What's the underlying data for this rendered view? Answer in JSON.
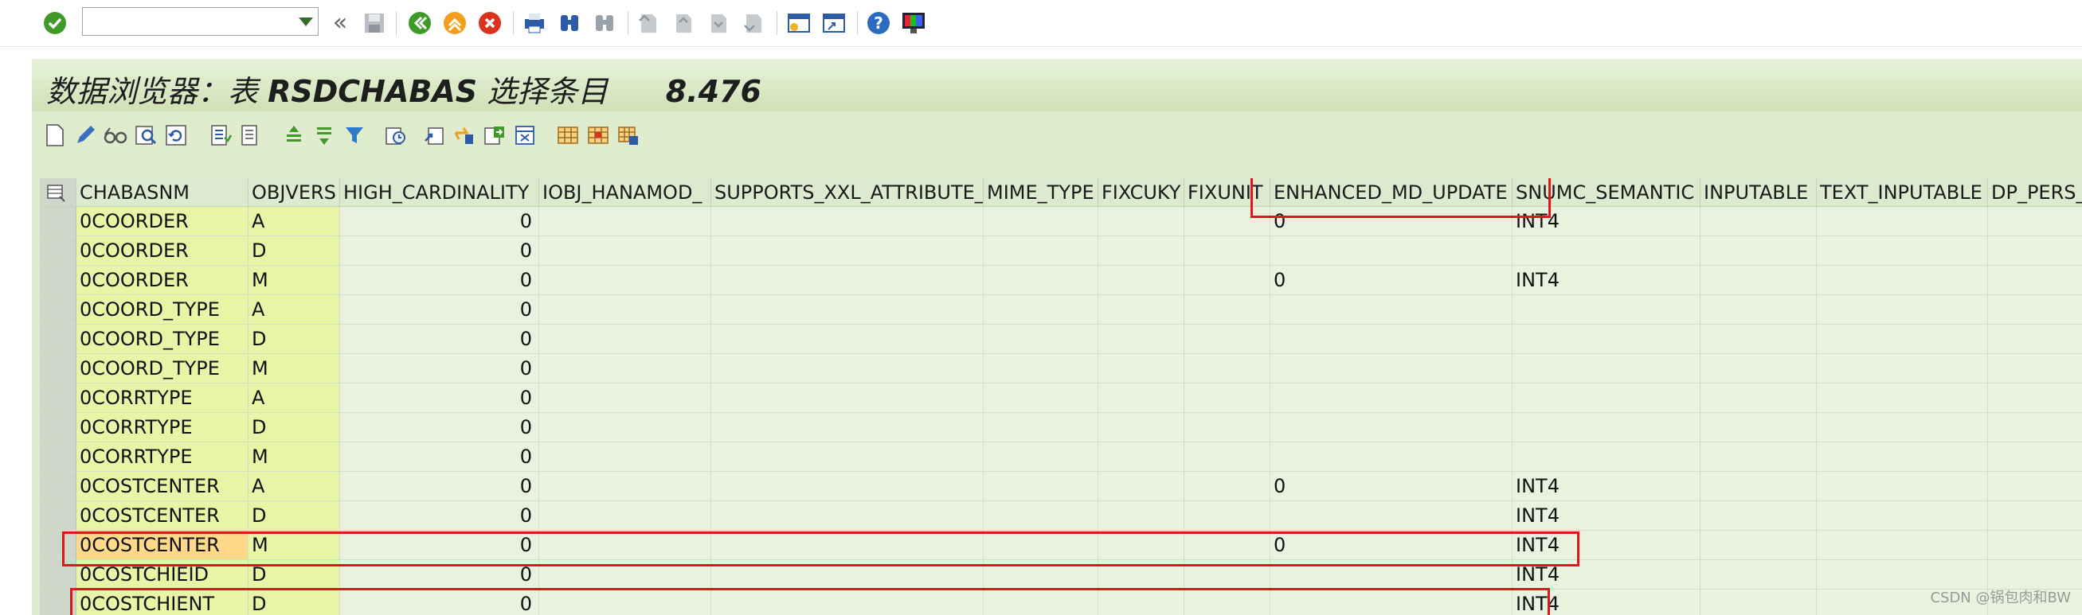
{
  "command_field": {
    "value": "",
    "placeholder": ""
  },
  "system_toolbar": {
    "icons": [
      "enter-icon",
      "back-double-icon",
      "save-icon",
      "back-icon",
      "exit-icon",
      "cancel-icon",
      "print-icon",
      "find-icon",
      "find-next-icon",
      "first-page-icon",
      "previous-page-icon",
      "next-page-icon",
      "last-page-icon",
      "create-session-icon",
      "shortcut-icon",
      "help-icon",
      "customize-layout-icon"
    ]
  },
  "title": {
    "prefix": "数据浏览器：表 ",
    "table": "RSDCHABAS",
    "suffix": " 选择条目",
    "count": "8.476"
  },
  "app_toolbar": {
    "icons": [
      "display-icon",
      "change-icon",
      "glasses-icon",
      "detail-icon",
      "refresh-icon",
      "check-table-icon",
      "check-table-2-icon",
      "sort-asc-icon",
      "sort-desc-icon",
      "filter-icon",
      "sum-icon",
      "export-icon",
      "find-icon",
      "print-icon",
      "excel-icon",
      "layout-icon",
      "select-layout-icon",
      "save-layout-icon"
    ]
  },
  "columns": [
    "CHABASNM",
    "OBJVERS",
    "HIGH_CARDINALITY",
    "IOBJ_HANAMOD_",
    "SUPPORTS_XXL_ATTRIBUTE_",
    "MIME_TYPE",
    "FIXCUKY",
    "FIXUNIT",
    "ENHANCED_MD_UPDATE",
    "SNUMC_SEMANTIC",
    "INPUTABLE",
    "TEXT_INPUTABLE",
    "DP_PERS_I"
  ],
  "rows": [
    {
      "CHABASNM": "0COORDER",
      "OBJVERS": "A",
      "HIGH_CARDINALITY": "0",
      "ENHANCED_MD_UPDATE": "0",
      "SNUMC_SEMANTIC": "INT4"
    },
    {
      "CHABASNM": "0COORDER",
      "OBJVERS": "D",
      "HIGH_CARDINALITY": "0",
      "ENHANCED_MD_UPDATE": "",
      "SNUMC_SEMANTIC": ""
    },
    {
      "CHABASNM": "0COORDER",
      "OBJVERS": "M",
      "HIGH_CARDINALITY": "0",
      "ENHANCED_MD_UPDATE": "0",
      "SNUMC_SEMANTIC": "INT4"
    },
    {
      "CHABASNM": "0COORD_TYPE",
      "OBJVERS": "A",
      "HIGH_CARDINALITY": "0",
      "ENHANCED_MD_UPDATE": "",
      "SNUMC_SEMANTIC": ""
    },
    {
      "CHABASNM": "0COORD_TYPE",
      "OBJVERS": "D",
      "HIGH_CARDINALITY": "0",
      "ENHANCED_MD_UPDATE": "",
      "SNUMC_SEMANTIC": ""
    },
    {
      "CHABASNM": "0COORD_TYPE",
      "OBJVERS": "M",
      "HIGH_CARDINALITY": "0",
      "ENHANCED_MD_UPDATE": "",
      "SNUMC_SEMANTIC": ""
    },
    {
      "CHABASNM": "0CORRTYPE",
      "OBJVERS": "A",
      "HIGH_CARDINALITY": "0",
      "ENHANCED_MD_UPDATE": "",
      "SNUMC_SEMANTIC": ""
    },
    {
      "CHABASNM": "0CORRTYPE",
      "OBJVERS": "D",
      "HIGH_CARDINALITY": "0",
      "ENHANCED_MD_UPDATE": "",
      "SNUMC_SEMANTIC": ""
    },
    {
      "CHABASNM": "0CORRTYPE",
      "OBJVERS": "M",
      "HIGH_CARDINALITY": "0",
      "ENHANCED_MD_UPDATE": "",
      "SNUMC_SEMANTIC": ""
    },
    {
      "CHABASNM": "0COSTCENTER",
      "OBJVERS": "A",
      "HIGH_CARDINALITY": "0",
      "ENHANCED_MD_UPDATE": "0",
      "SNUMC_SEMANTIC": "INT4"
    },
    {
      "CHABASNM": "0COSTCENTER",
      "OBJVERS": "D",
      "HIGH_CARDINALITY": "0",
      "ENHANCED_MD_UPDATE": "",
      "SNUMC_SEMANTIC": "INT4"
    },
    {
      "CHABASNM": "0COSTCENTER",
      "OBJVERS": "M",
      "HIGH_CARDINALITY": "0",
      "ENHANCED_MD_UPDATE": "0",
      "SNUMC_SEMANTIC": "INT4"
    },
    {
      "CHABASNM": "0COSTCHIEID",
      "OBJVERS": "D",
      "HIGH_CARDINALITY": "0",
      "ENHANCED_MD_UPDATE": "",
      "SNUMC_SEMANTIC": "INT4"
    },
    {
      "CHABASNM": "0COSTCHIENT",
      "OBJVERS": "D",
      "HIGH_CARDINALITY": "0",
      "ENHANCED_MD_UPDATE": "",
      "SNUMC_SEMANTIC": "INT4"
    }
  ],
  "watermark": "CSDN @锅包肉和BW",
  "colors": {
    "screen_bg": "#dfeccd",
    "key_column": "#e8f5a7",
    "focus_cell": "#ffd98a",
    "highlight_box": "#e0161b"
  }
}
